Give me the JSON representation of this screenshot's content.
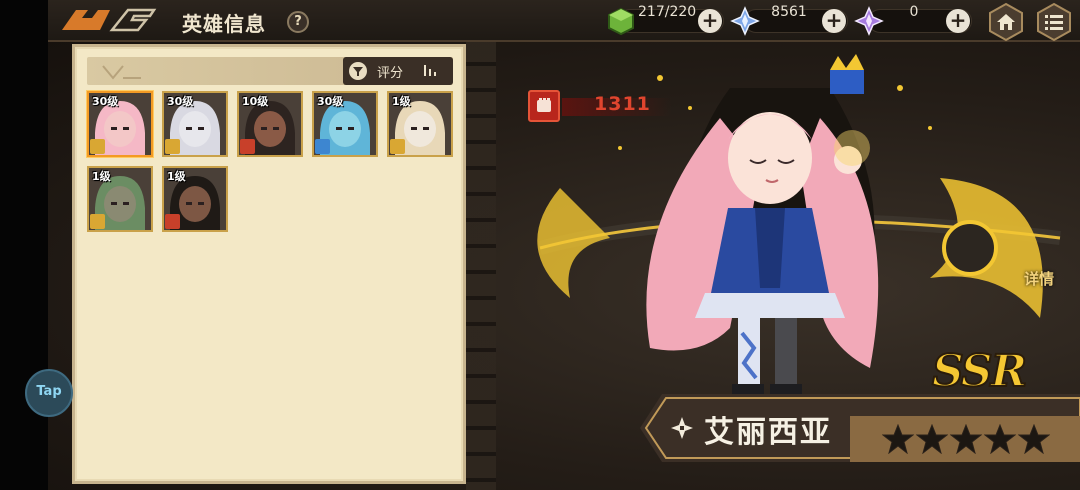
{
  "header": {
    "title": "英雄信息",
    "help_label": "?"
  },
  "resources": {
    "stamina": {
      "value": "217/220",
      "icon": "green-cube-icon"
    },
    "crystal": {
      "value": "8561",
      "icon": "blue-crystal-icon"
    },
    "premium": {
      "value": "0",
      "icon": "purple-crystal-icon"
    },
    "plus_label": "+"
  },
  "nav": {
    "home_icon": "home-icon",
    "menu_icon": "menu-icon"
  },
  "panel": {
    "sort_label": "评分",
    "heroes": [
      {
        "level": "30级",
        "selected": true,
        "badge": "gold",
        "skin": "#f3c7c7",
        "hair": "#f5b8c6"
      },
      {
        "level": "30级",
        "selected": false,
        "badge": "gold",
        "skin": "#e7e7ec",
        "hair": "#d9d9e2"
      },
      {
        "level": "10级",
        "selected": false,
        "badge": "red",
        "skin": "#8a5a46",
        "hair": "#2d2420"
      },
      {
        "level": "30级",
        "selected": false,
        "badge": "blue",
        "skin": "#8dd3e6",
        "hair": "#5fb5d8"
      },
      {
        "level": "1级",
        "selected": false,
        "badge": "gold",
        "skin": "#f0e8dc",
        "hair": "#e8d8b8"
      },
      {
        "level": "1级",
        "selected": false,
        "badge": "gold",
        "skin": "#8a8a72",
        "hair": "#6b8d63"
      },
      {
        "level": "1级",
        "selected": false,
        "badge": "red",
        "skin": "#7d5744",
        "hair": "#1f1a16"
      }
    ]
  },
  "hero": {
    "power": "1311",
    "name": "艾丽西亚",
    "rarity": "SSR",
    "stars": 5,
    "detail_label": "详情"
  },
  "overlay": {
    "tap_label": "Tap"
  },
  "colors": {
    "accent_gold": "#f5c733",
    "power_red": "#e0452e",
    "panel_bg": "#f3e8c6"
  }
}
